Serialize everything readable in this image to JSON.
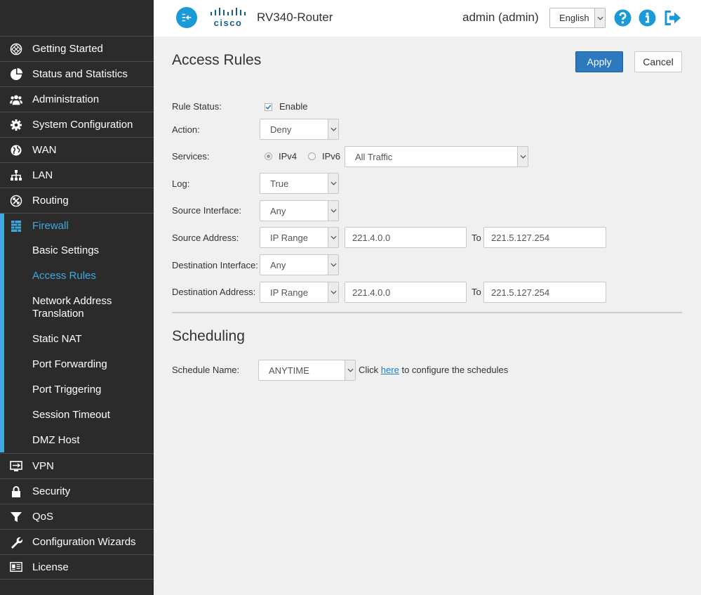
{
  "sidebar": {
    "items": [
      {
        "label": "Getting Started",
        "icon": "getting-started-icon"
      },
      {
        "label": "Status and Statistics",
        "icon": "pie-chart-icon"
      },
      {
        "label": "Administration",
        "icon": "users-icon"
      },
      {
        "label": "System Configuration",
        "icon": "gear-icon"
      },
      {
        "label": "WAN",
        "icon": "globe-icon"
      },
      {
        "label": "LAN",
        "icon": "network-icon"
      },
      {
        "label": "Routing",
        "icon": "routing-icon"
      },
      {
        "label": "Firewall",
        "icon": "firewall-icon"
      }
    ],
    "firewall_sub": [
      {
        "label": "Basic Settings"
      },
      {
        "label": "Access Rules"
      },
      {
        "label": "Network Address Translation"
      },
      {
        "label": "Static NAT"
      },
      {
        "label": "Port Forwarding"
      },
      {
        "label": "Port Triggering"
      },
      {
        "label": "Session Timeout"
      },
      {
        "label": "DMZ Host"
      }
    ],
    "bottom_items": [
      {
        "label": "VPN",
        "icon": "vpn-icon"
      },
      {
        "label": "Security",
        "icon": "lock-icon"
      },
      {
        "label": "QoS",
        "icon": "filter-icon"
      },
      {
        "label": "Configuration Wizards",
        "icon": "wrench-icon"
      },
      {
        "label": "License",
        "icon": "license-icon"
      }
    ],
    "accent_color": "#3fa9e0"
  },
  "header": {
    "logo_text": "cisco",
    "router_name": "RV340-Router",
    "user": "admin (admin)",
    "language": "English"
  },
  "page": {
    "title": "Access Rules",
    "apply_label": "Apply",
    "cancel_label": "Cancel"
  },
  "form": {
    "rule_status_label": "Rule Status:",
    "enable_label": "Enable",
    "action_label": "Action:",
    "action_value": "Deny",
    "services_label": "Services:",
    "ipv4_label": "IPv4",
    "ipv6_label": "IPv6",
    "services_value": "All Traffic",
    "log_label": "Log:",
    "log_value": "True",
    "src_if_label": "Source Interface:",
    "src_if_value": "Any",
    "src_addr_label": "Source Address:",
    "src_addr_type": "IP Range",
    "src_from": "221.4.0.0",
    "to_label": "To",
    "src_to": "221.5.127.254",
    "dst_if_label": "Destination Interface:",
    "dst_if_value": "Any",
    "dst_addr_label": "Destination Address:",
    "dst_addr_type": "IP Range",
    "dst_from": "221.4.0.0",
    "dst_to": "221.5.127.254"
  },
  "scheduling": {
    "title": "Scheduling",
    "name_label": "Schedule Name:",
    "name_value": "ANYTIME",
    "click_text": "Click",
    "here_link": "here",
    "configure_text": "to configure the schedules"
  },
  "colors": {
    "apply_blue": "#2c79bd",
    "header_icon_blue": "#1a9ad6"
  }
}
